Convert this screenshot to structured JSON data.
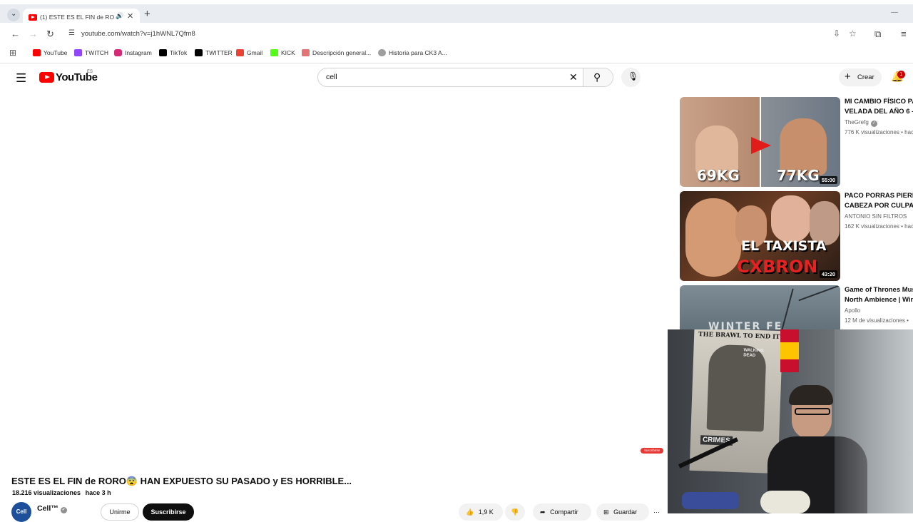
{
  "browser": {
    "tab_title": "(1) ESTE ES EL FIN de RORO",
    "new_tab_symbol": "+",
    "url": "youtube.com/watch?v=j1hWNL7Qfm8",
    "bookmarks": [
      {
        "label": "YouTube",
        "color": "#ff0000"
      },
      {
        "label": "TWITCH",
        "color": "#9146ff"
      },
      {
        "label": "Instagram",
        "color": "#d62976"
      },
      {
        "label": "TikTok",
        "color": "#000000"
      },
      {
        "label": "TWITTER",
        "color": "#000000"
      },
      {
        "label": "Gmail",
        "color": "#ea4335"
      },
      {
        "label": "KICK",
        "color": "#53fc18"
      },
      {
        "label": "Descripción general...",
        "color": "#e57373"
      },
      {
        "label": "Historia para CK3 A...",
        "color": "#9e9e9e"
      }
    ]
  },
  "youtube": {
    "logo_text": "YouTube",
    "country_code": "ES",
    "search_query": "cell",
    "create_label": "Crear",
    "notification_count": "1",
    "brand_color": "#ff0000"
  },
  "recommendations": [
    {
      "title": "MI CAMBIO FÍSICO PA\nVELADA DEL AÑO 6 - ...",
      "channel": "TheGrefg",
      "verified": true,
      "meta": "776 K visualizaciones • hac",
      "duration": "55:00",
      "thumb_left_text": "69KG",
      "thumb_right_text": "77KG"
    },
    {
      "title": "PACO PORRAS PIERD\nCABEZA POR CULPA D",
      "channel": "ANTONIO SIN FILTROS",
      "verified": false,
      "meta": "162 K visualizaciones • hac",
      "duration": "43:20",
      "thumb_line1": "EL TAXISTA",
      "thumb_line2": "CXBRON"
    },
    {
      "title": "Game of Thrones Mus\nNorth Ambience | Wint",
      "channel": "Apollo",
      "verified": false,
      "meta": "12 M de visualizaciones •",
      "thumb_text": "WINTER FE"
    }
  ],
  "video": {
    "title": "ESTE ES EL FIN de RORO😨 HAN EXPUESTO SU PASADO y ES HORRIBLE...",
    "views": "18.216 visualizaciones",
    "age": "hace 3 h",
    "channel_name": "Cell™",
    "avatar_text": "Cell",
    "join_label": "Unirme",
    "subscribe_label": "Suscribirse",
    "likes": "1,9 K",
    "share_label": "Compartir",
    "save_label": "Guardar",
    "mini_subscribe": "Suscribirse"
  },
  "webcam": {
    "poster_text": "THE BRAWL TO END IT ALL",
    "poster_sub": "WALKING DEAD",
    "poster_bottom": "CRIMES"
  }
}
